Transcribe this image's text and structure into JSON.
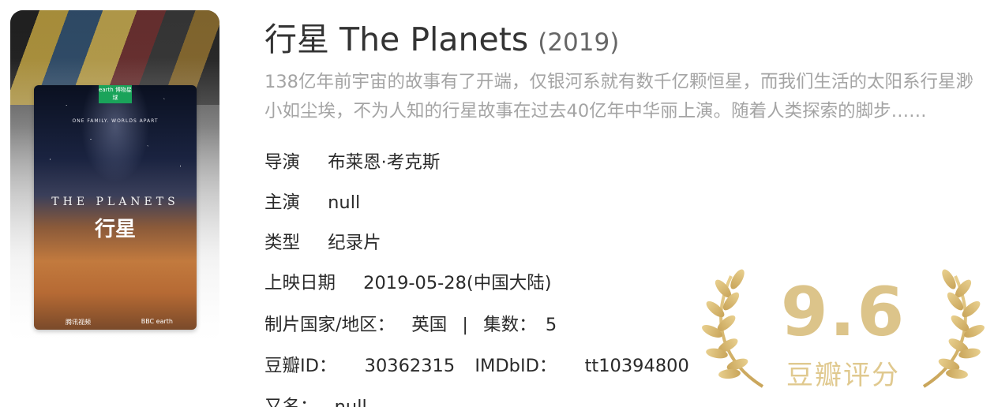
{
  "poster": {
    "badge": "earth\n博物星球",
    "tagline": "ONE FAMILY. WORLDS APART",
    "title": "THE PLANETS",
    "title_cn": "行星",
    "foot_left": "腾讯视频",
    "foot_right": "BBC earth"
  },
  "movie": {
    "title": "行星 The Planets",
    "year": "(2019)",
    "description": "138亿年前宇宙的故事有了开端，仅银河系就有数千亿颗恒星，而我们生活的太阳系行星渺小如尘埃，不为人知的行星故事在过去40亿年中华丽上演。随着人类探索的脚步……"
  },
  "meta": {
    "director_label": "导演",
    "director_value": "布莱恩·考克斯",
    "cast_label": "主演",
    "cast_value": "null",
    "genre_label": "类型",
    "genre_value": "纪录片",
    "release_label": "上映日期",
    "release_value": "2019-05-28(中国大陆)",
    "country_label": "制片国家/地区：",
    "country_value": "英国",
    "divider": "|",
    "episodes_label": "集数：",
    "episodes_value": "5",
    "douban_id_label": "豆瓣ID：",
    "douban_id_value": "30362315",
    "imdb_label": "IMDbID：",
    "imdb_value": "tt10394800",
    "aka_label": "又名：",
    "aka_value": "null"
  },
  "rating": {
    "score": "9.6",
    "label": "豆瓣评分",
    "color": "#dcc48a"
  }
}
